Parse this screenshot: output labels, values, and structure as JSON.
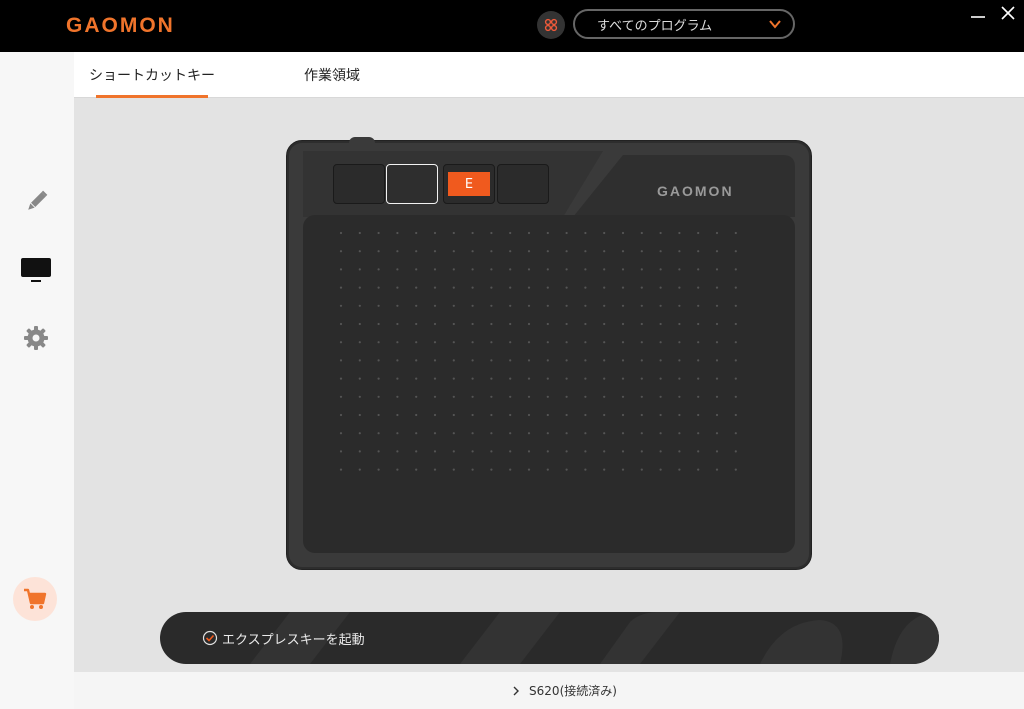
{
  "app": {
    "logo": "GAOMON",
    "program_select": "すべてのプログラム"
  },
  "tabs": [
    {
      "label": "ショートカットキー",
      "active": true
    },
    {
      "label": "作業領域",
      "active": false
    }
  ],
  "tablet": {
    "brand": "GAOMON",
    "keys": [
      {
        "label": ""
      },
      {
        "label": "",
        "selected": true
      },
      {
        "label": "E"
      },
      {
        "label": ""
      }
    ]
  },
  "express": {
    "label": "エクスプレスキーを起動",
    "checked": true
  },
  "footer": {
    "device": "S620(接続済み)"
  },
  "colors": {
    "accent": "#f0742b",
    "key_label": "#f05a1e"
  },
  "icons": {
    "sidebar": [
      "pen-icon",
      "monitor-icon",
      "gear-icon"
    ],
    "cart": "cart-icon"
  }
}
